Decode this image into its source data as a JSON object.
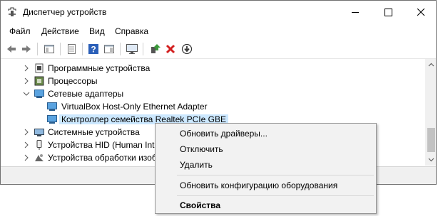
{
  "window": {
    "title": "Диспетчер устройств"
  },
  "menu": [
    "Файл",
    "Действие",
    "Вид",
    "Справка"
  ],
  "toolbar": {
    "buttons": [
      "back-icon",
      "forward-icon",
      "properties-window-icon",
      "page-icon",
      "help-icon",
      "view-icon",
      "monitor-icon",
      "update-driver-icon",
      "delete-icon",
      "download-icon"
    ]
  },
  "tree": {
    "items": [
      {
        "label": "Программные устройства",
        "icon": "software-device-icon",
        "state": "collapsed"
      },
      {
        "label": "Процессоры",
        "icon": "processor-icon",
        "state": "collapsed"
      },
      {
        "label": "Сетевые адаптеры",
        "icon": "network-adapter-icon",
        "state": "expanded"
      },
      {
        "label": "VirtualBox Host-Only Ethernet Adapter",
        "icon": "network-adapter-icon",
        "state": "child"
      },
      {
        "label": "Контроллер семейства Realtek PCIe GBE",
        "icon": "network-adapter-icon",
        "state": "child-selected"
      },
      {
        "label": "Системные устройства",
        "icon": "system-device-icon",
        "state": "collapsed"
      },
      {
        "label": "Устройства HID (Human Inte",
        "icon": "hid-icon",
        "state": "collapsed"
      },
      {
        "label": "Устройства обработки изоб",
        "icon": "imaging-icon",
        "state": "collapsed"
      }
    ]
  },
  "context_menu": {
    "update_drivers": "Обновить драйверы...",
    "disable": "Отключить",
    "delete": "Удалить",
    "scan": "Обновить конфигурацию оборудования",
    "properties": "Свойства"
  },
  "colors": {
    "selection": "#cce8ff",
    "menu_bg": "#f2f2f2",
    "accent_green": "#3a9a3a",
    "accent_red": "#d32020",
    "help_blue": "#2b5fb8"
  }
}
